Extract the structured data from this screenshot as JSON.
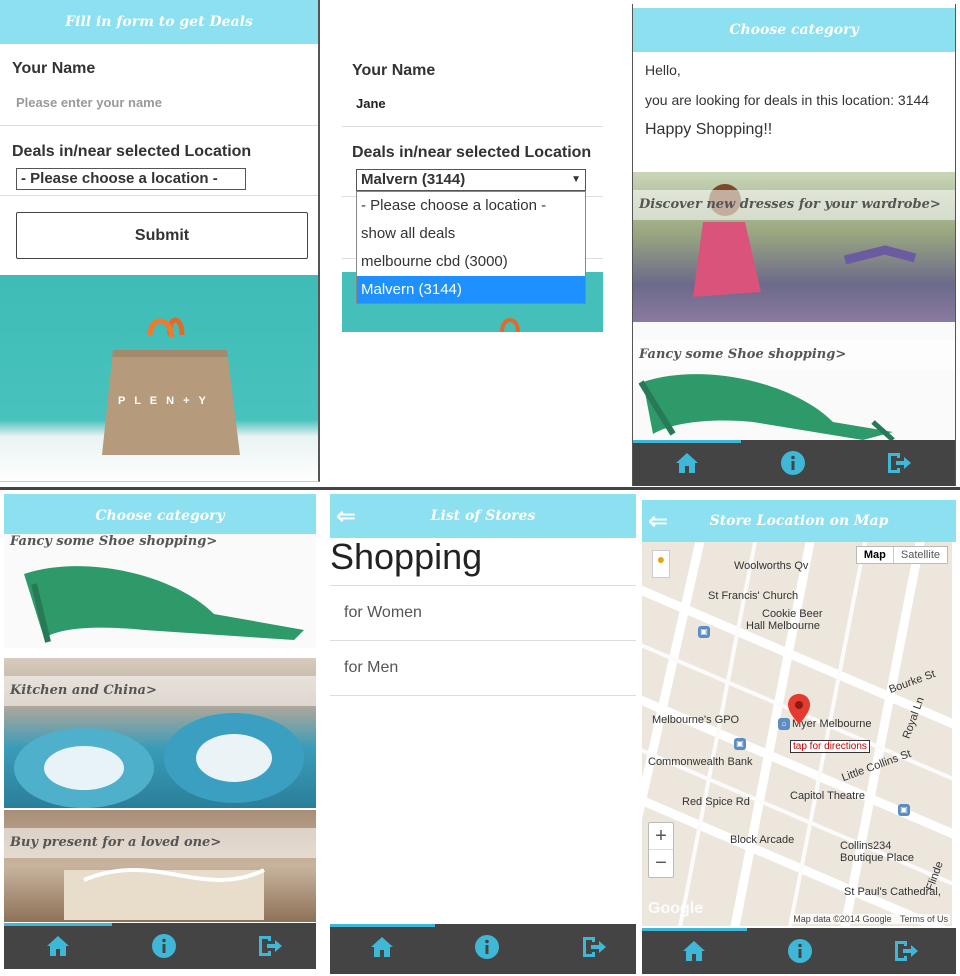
{
  "form_screen": {
    "header_title": "Fill in form to get Deals",
    "name_label": "Your Name",
    "name_placeholder": "Please enter your name",
    "location_label": "Deals in/near selected Location",
    "location_selected": "- Please choose a location -",
    "submit_label": "Submit",
    "bag_brand": "P L E N + Y"
  },
  "dropdown_screen": {
    "name_label": "Your Name",
    "name_value": "Jane",
    "location_label": "Deals in/near selected Location",
    "location_selected": "Malvern (3144)",
    "options": [
      "- Please choose a location -",
      "show all deals",
      "melbourne cbd (3000)",
      "Malvern (3144)"
    ],
    "highlighted_option_index": 3
  },
  "category_screen_1": {
    "header_title": "Choose category",
    "greeting": "Hello,",
    "location_message": "you are looking for deals in this location: 3144",
    "happy_message": "Happy Shopping!!",
    "categories": [
      "Discover new dresses for your wardrobe>",
      "Fancy some Shoe shopping>"
    ]
  },
  "category_screen_2": {
    "header_title": "Choose category",
    "categories": [
      "Fancy some Shoe shopping>",
      "Kitchen and China>",
      "Buy present for a loved one>"
    ]
  },
  "stores_screen": {
    "header_title": "List of Stores",
    "section_title": "Shopping",
    "items": [
      "for Women",
      "for Men"
    ]
  },
  "map_screen": {
    "header_title": "Store Location on Map",
    "map_type_options": [
      "Map",
      "Satellite"
    ],
    "selected_map_type": "Map",
    "places": [
      "Woolworths Qv",
      "St Francis' Church",
      "Cookie Beer",
      "Hall Melbourne",
      "Melbourne's GPO",
      "Myer Melbourne",
      "Commonwealth Bank",
      "Little Collins St",
      "Bourke St",
      "Royal Ln",
      "Capitol Theatre",
      "Red Spice Rd",
      "Block Arcade",
      "Collins234",
      "Boutique Place",
      "St Paul's Cathedral,",
      "Flinde"
    ],
    "marker_tooltip": "tap for directions",
    "zoom_in": "+",
    "zoom_out": "−",
    "attribution": "Map data ©2014 Google",
    "terms": "Terms of Us",
    "google_logo": "Google"
  },
  "footer": {
    "icons": [
      "home-icon",
      "info-icon",
      "logout-icon"
    ]
  },
  "colors": {
    "header": "#8ce0ef",
    "accent": "#3fb8d8",
    "footer": "#444444",
    "selected_option": "#1e90ff"
  }
}
